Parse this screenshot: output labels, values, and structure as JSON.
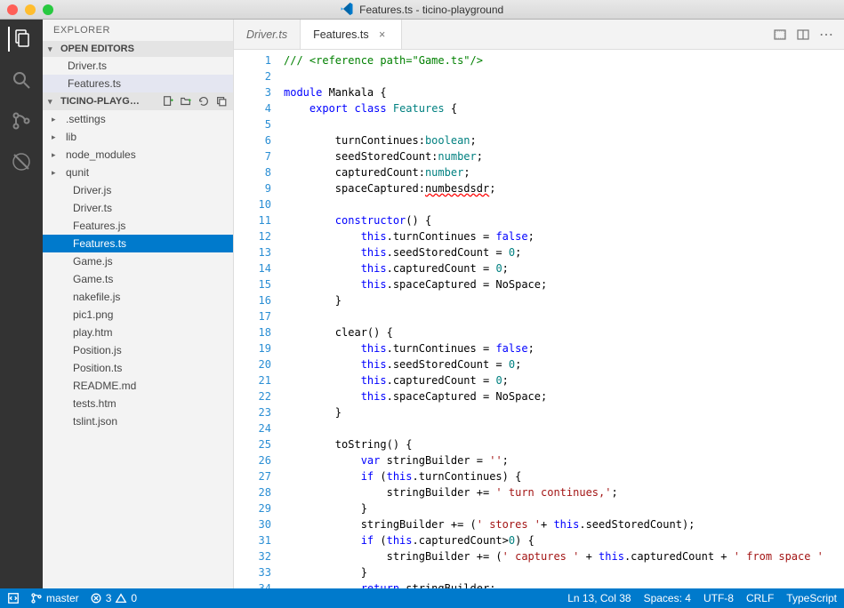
{
  "window": {
    "title": "Features.ts - ticino-playground"
  },
  "sidebar": {
    "title": "EXPLORER",
    "sections": {
      "openEditors": {
        "title": "OPEN EDITORS",
        "items": [
          {
            "name": "Driver.ts",
            "selected": false
          },
          {
            "name": "Features.ts",
            "selected": true
          }
        ]
      },
      "project": {
        "title": "TICINO-PLAYG…",
        "folders": [
          {
            "name": ".settings"
          },
          {
            "name": "lib"
          },
          {
            "name": "node_modules"
          },
          {
            "name": "qunit"
          }
        ],
        "files": [
          {
            "name": "Driver.js"
          },
          {
            "name": "Driver.ts"
          },
          {
            "name": "Features.js"
          },
          {
            "name": "Features.ts",
            "selected": true
          },
          {
            "name": "Game.js"
          },
          {
            "name": "Game.ts"
          },
          {
            "name": "nakefile.js"
          },
          {
            "name": "pic1.png"
          },
          {
            "name": "play.htm"
          },
          {
            "name": "Position.js"
          },
          {
            "name": "Position.ts"
          },
          {
            "name": "README.md"
          },
          {
            "name": "tests.htm"
          },
          {
            "name": "tslint.json"
          }
        ]
      }
    }
  },
  "tabs": [
    {
      "label": "Driver.ts",
      "active": false
    },
    {
      "label": "Features.ts",
      "active": true
    }
  ],
  "code": {
    "lines": [
      [
        [
          "c-green",
          "/// <reference path=\"Game.ts\"/>"
        ]
      ],
      [],
      [
        [
          "c-blue",
          "module"
        ],
        [
          "c-black",
          " Mankala {"
        ]
      ],
      [
        [
          "c-black",
          "    "
        ],
        [
          "c-blue",
          "export"
        ],
        [
          "c-black",
          " "
        ],
        [
          "c-blue",
          "class"
        ],
        [
          "c-black",
          " "
        ],
        [
          "c-teal",
          "Features"
        ],
        [
          "c-black",
          " {"
        ]
      ],
      [],
      [
        [
          "c-black",
          "        turnContinues:"
        ],
        [
          "c-teal",
          "boolean"
        ],
        [
          "c-black",
          ";"
        ]
      ],
      [
        [
          "c-black",
          "        seedStoredCount:"
        ],
        [
          "c-teal",
          "number"
        ],
        [
          "c-black",
          ";"
        ]
      ],
      [
        [
          "c-black",
          "        capturedCount:"
        ],
        [
          "c-teal",
          "number"
        ],
        [
          "c-black",
          ";"
        ]
      ],
      [
        [
          "c-black",
          "        spaceCaptured:"
        ],
        [
          "squiggle",
          "numbesdsdr"
        ],
        [
          "c-black",
          ";"
        ]
      ],
      [],
      [
        [
          "c-black",
          "        "
        ],
        [
          "c-blue",
          "constructor"
        ],
        [
          "c-black",
          "() {"
        ]
      ],
      [
        [
          "c-black",
          "            "
        ],
        [
          "c-blue",
          "this"
        ],
        [
          "c-black",
          ".turnContinues = "
        ],
        [
          "c-blue",
          "false"
        ],
        [
          "c-black",
          ";"
        ]
      ],
      [
        [
          "c-black",
          "            "
        ],
        [
          "c-blue",
          "this"
        ],
        [
          "c-black",
          ".seedStoredCount = "
        ],
        [
          "c-teal",
          "0"
        ],
        [
          "c-black",
          ";"
        ]
      ],
      [
        [
          "c-black",
          "            "
        ],
        [
          "c-blue",
          "this"
        ],
        [
          "c-black",
          ".capturedCount = "
        ],
        [
          "c-teal",
          "0"
        ],
        [
          "c-black",
          ";"
        ]
      ],
      [
        [
          "c-black",
          "            "
        ],
        [
          "c-blue",
          "this"
        ],
        [
          "c-black",
          ".spaceCaptured = NoSpace;"
        ]
      ],
      [
        [
          "c-black",
          "        }"
        ]
      ],
      [],
      [
        [
          "c-black",
          "        clear() {"
        ]
      ],
      [
        [
          "c-black",
          "            "
        ],
        [
          "c-blue",
          "this"
        ],
        [
          "c-black",
          ".turnContinues = "
        ],
        [
          "c-blue",
          "false"
        ],
        [
          "c-black",
          ";"
        ]
      ],
      [
        [
          "c-black",
          "            "
        ],
        [
          "c-blue",
          "this"
        ],
        [
          "c-black",
          ".seedStoredCount = "
        ],
        [
          "c-teal",
          "0"
        ],
        [
          "c-black",
          ";"
        ]
      ],
      [
        [
          "c-black",
          "            "
        ],
        [
          "c-blue",
          "this"
        ],
        [
          "c-black",
          ".capturedCount = "
        ],
        [
          "c-teal",
          "0"
        ],
        [
          "c-black",
          ";"
        ]
      ],
      [
        [
          "c-black",
          "            "
        ],
        [
          "c-blue",
          "this"
        ],
        [
          "c-black",
          ".spaceCaptured = NoSpace;"
        ]
      ],
      [
        [
          "c-black",
          "        }"
        ]
      ],
      [],
      [
        [
          "c-black",
          "        toString() {"
        ]
      ],
      [
        [
          "c-black",
          "            "
        ],
        [
          "c-blue",
          "var"
        ],
        [
          "c-black",
          " stringBuilder = "
        ],
        [
          "c-red",
          "''"
        ],
        [
          "c-black",
          ";"
        ]
      ],
      [
        [
          "c-black",
          "            "
        ],
        [
          "c-blue",
          "if"
        ],
        [
          "c-black",
          " ("
        ],
        [
          "c-blue",
          "this"
        ],
        [
          "c-black",
          ".turnContinues) {"
        ]
      ],
      [
        [
          "c-black",
          "                stringBuilder += "
        ],
        [
          "c-red",
          "' turn continues,'"
        ],
        [
          "c-black",
          ";"
        ]
      ],
      [
        [
          "c-black",
          "            }"
        ]
      ],
      [
        [
          "c-black",
          "            stringBuilder += ("
        ],
        [
          "c-red",
          "' stores '"
        ],
        [
          "c-black",
          "+ "
        ],
        [
          "c-blue",
          "this"
        ],
        [
          "c-black",
          ".seedStoredCount);"
        ]
      ],
      [
        [
          "c-black",
          "            "
        ],
        [
          "c-blue",
          "if"
        ],
        [
          "c-black",
          " ("
        ],
        [
          "c-blue",
          "this"
        ],
        [
          "c-black",
          ".capturedCount>"
        ],
        [
          "c-teal",
          "0"
        ],
        [
          "c-black",
          ") {"
        ]
      ],
      [
        [
          "c-black",
          "                stringBuilder += ("
        ],
        [
          "c-red",
          "' captures '"
        ],
        [
          "c-black",
          " + "
        ],
        [
          "c-blue",
          "this"
        ],
        [
          "c-black",
          ".capturedCount + "
        ],
        [
          "c-red",
          "' from space '"
        ]
      ],
      [
        [
          "c-black",
          "            }"
        ]
      ],
      [
        [
          "c-black",
          "            "
        ],
        [
          "c-blue",
          "return"
        ],
        [
          "c-black",
          " stringBuilder;"
        ]
      ]
    ]
  },
  "statusbar": {
    "branch": "master",
    "errors": "3",
    "warnings": "0",
    "position": "Ln 13, Col 38",
    "spaces": "Spaces: 4",
    "encoding": "UTF-8",
    "eol": "CRLF",
    "language": "TypeScript"
  }
}
